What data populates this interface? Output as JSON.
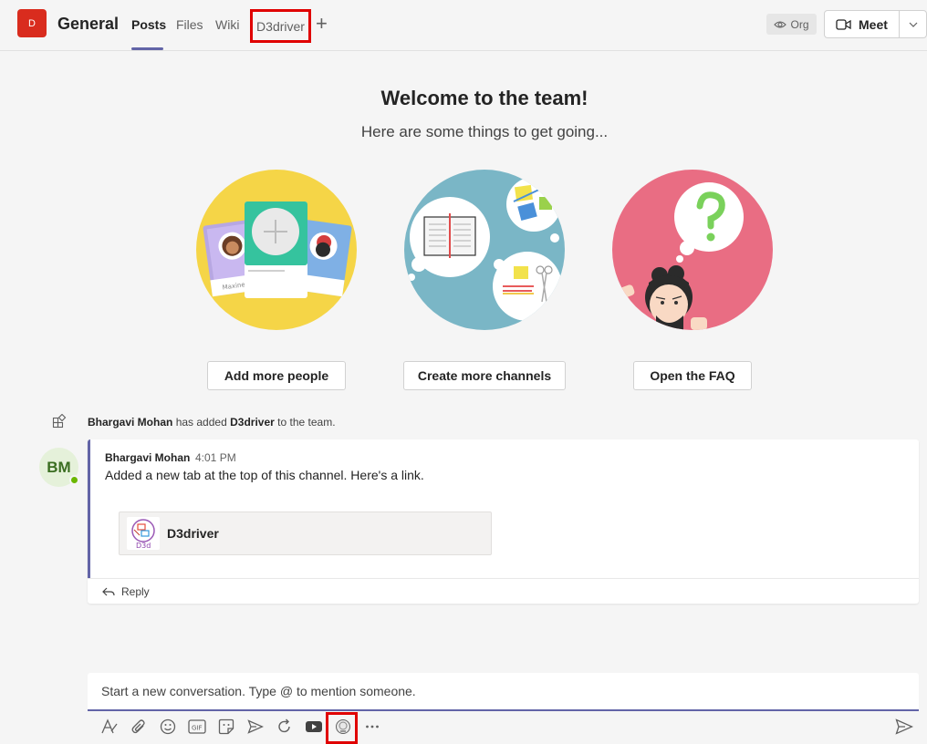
{
  "header": {
    "team_initial": "D",
    "channel_name": "General",
    "tabs": [
      {
        "label": "Posts",
        "active": true
      },
      {
        "label": "Files"
      },
      {
        "label": "Wiki"
      },
      {
        "label": "D3driver",
        "highlighted": true
      }
    ],
    "add_tab_icon": "plus-icon",
    "org_label": "Org",
    "meet_label": "Meet"
  },
  "welcome": {
    "title": "Welcome to the team!",
    "subtitle": "Here are some things to get going...",
    "actions": [
      {
        "label": "Add more people"
      },
      {
        "label": "Create more channels"
      },
      {
        "label": "Open the FAQ"
      }
    ],
    "card_names": [
      "Maxine",
      "ky"
    ]
  },
  "system_message": {
    "actor": "Bhargavi Mohan",
    "text_mid": "has added",
    "subject": "D3driver",
    "text_end": "to the team."
  },
  "message": {
    "avatar_initials": "BM",
    "author": "Bhargavi Mohan",
    "time": "4:01 PM",
    "body": "Added a new tab at the top of this channel. Here's a link.",
    "link_title": "D3driver",
    "link_thumb_text": "D3d",
    "reply_label": "Reply"
  },
  "compose": {
    "placeholder": "Start a new conversation. Type @ to mention someone.",
    "toolbar_icons": [
      "format-icon",
      "attach-icon",
      "emoji-icon",
      "gif-icon",
      "sticker-icon",
      "meet-now-icon",
      "loop-icon",
      "youtube-icon",
      "d3driver-app-icon",
      "more-icon"
    ],
    "send_icon": "send-icon"
  },
  "colors": {
    "accent": "#6264a7",
    "team_avatar": "#d92c1e",
    "highlight": "#e00000",
    "presence": "#6bb700"
  }
}
